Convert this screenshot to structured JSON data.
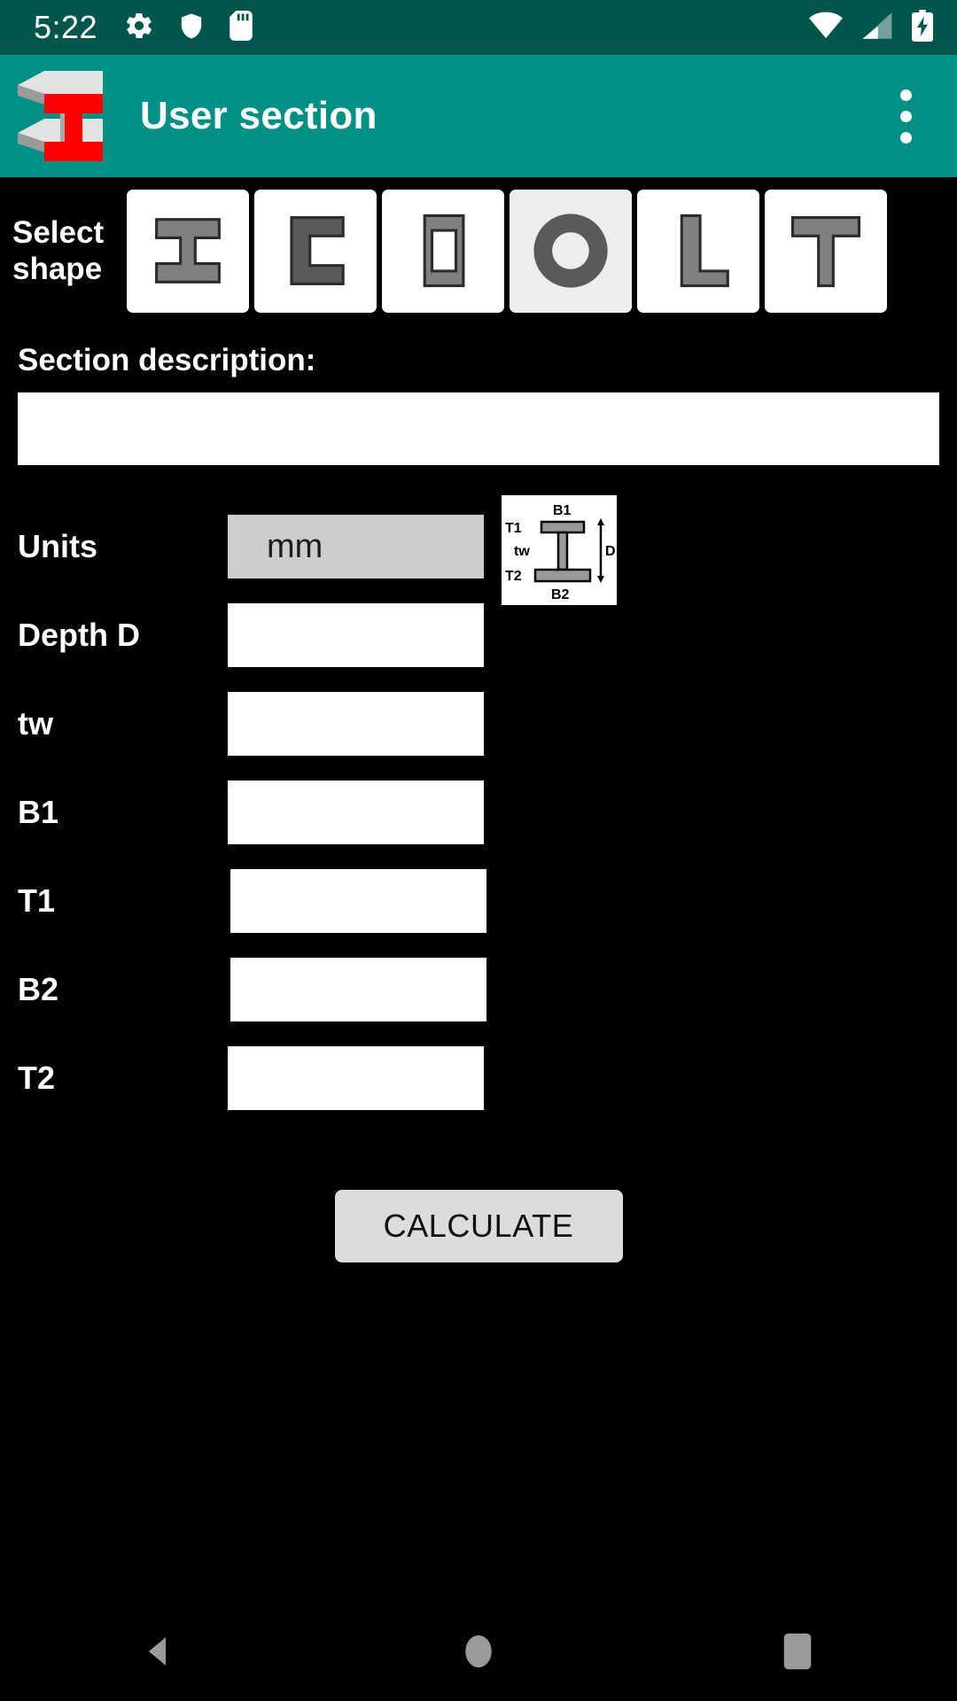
{
  "status_bar": {
    "time": "5:22",
    "left_icons": [
      "gear-icon",
      "shield-icon",
      "sd-card-icon"
    ],
    "right_icons": [
      "wifi-icon",
      "cellular-signal-icon",
      "battery-charging-icon"
    ],
    "background_color": "#00564B"
  },
  "app_bar": {
    "title": "User section",
    "logo": "i-beam-logo",
    "overflow_menu": "more-options-icon",
    "background_color": "#009184"
  },
  "shape_selector": {
    "label_line1": "Select",
    "label_line2": "shape",
    "selected_index": 3,
    "options": [
      {
        "name": "i-beam",
        "glyph": "I"
      },
      {
        "name": "c-channel",
        "glyph": "C"
      },
      {
        "name": "rectangular-hollow",
        "glyph": "RHS"
      },
      {
        "name": "circular-hollow",
        "glyph": "CHS"
      },
      {
        "name": "l-angle",
        "glyph": "L"
      },
      {
        "name": "t-section",
        "glyph": "T"
      }
    ]
  },
  "description": {
    "label": "Section description:",
    "value": "",
    "placeholder": ""
  },
  "dimension_diagram": {
    "name": "i-beam-dimension-diagram",
    "labels": {
      "top_flange_width": "B1",
      "top_flange_thickness": "T1",
      "web_thickness": "tw",
      "bottom_flange_thickness": "T2",
      "bottom_flange_width": "B2",
      "depth": "D"
    }
  },
  "fields": [
    {
      "name": "units",
      "label": "Units",
      "type": "spinner",
      "value": "mm"
    },
    {
      "name": "depth-d",
      "label": "Depth D",
      "type": "input",
      "value": ""
    },
    {
      "name": "tw",
      "label": "tw",
      "type": "input",
      "value": ""
    },
    {
      "name": "b1",
      "label": "B1",
      "type": "input",
      "value": ""
    },
    {
      "name": "t1",
      "label": "T1",
      "type": "input",
      "value": ""
    },
    {
      "name": "b2",
      "label": "B2",
      "type": "input",
      "value": ""
    },
    {
      "name": "t2",
      "label": "T2",
      "type": "input",
      "value": ""
    }
  ],
  "actions": {
    "calculate_label": "CALCULATE"
  },
  "nav_bar": {
    "back": "back-triangle-icon",
    "home": "home-circle-icon",
    "recents": "recents-square-icon"
  },
  "colors": {
    "status_bar": "#00564B",
    "app_bar": "#009184",
    "page_background": "#000000",
    "field_background": "#ffffff",
    "spinner_background": "#cdcdcd",
    "button_background": "#dcdcdc",
    "shape_fill": "#808080",
    "shape_fill_dark": "#5a5a5a",
    "logo_accent": "#ff0000"
  }
}
